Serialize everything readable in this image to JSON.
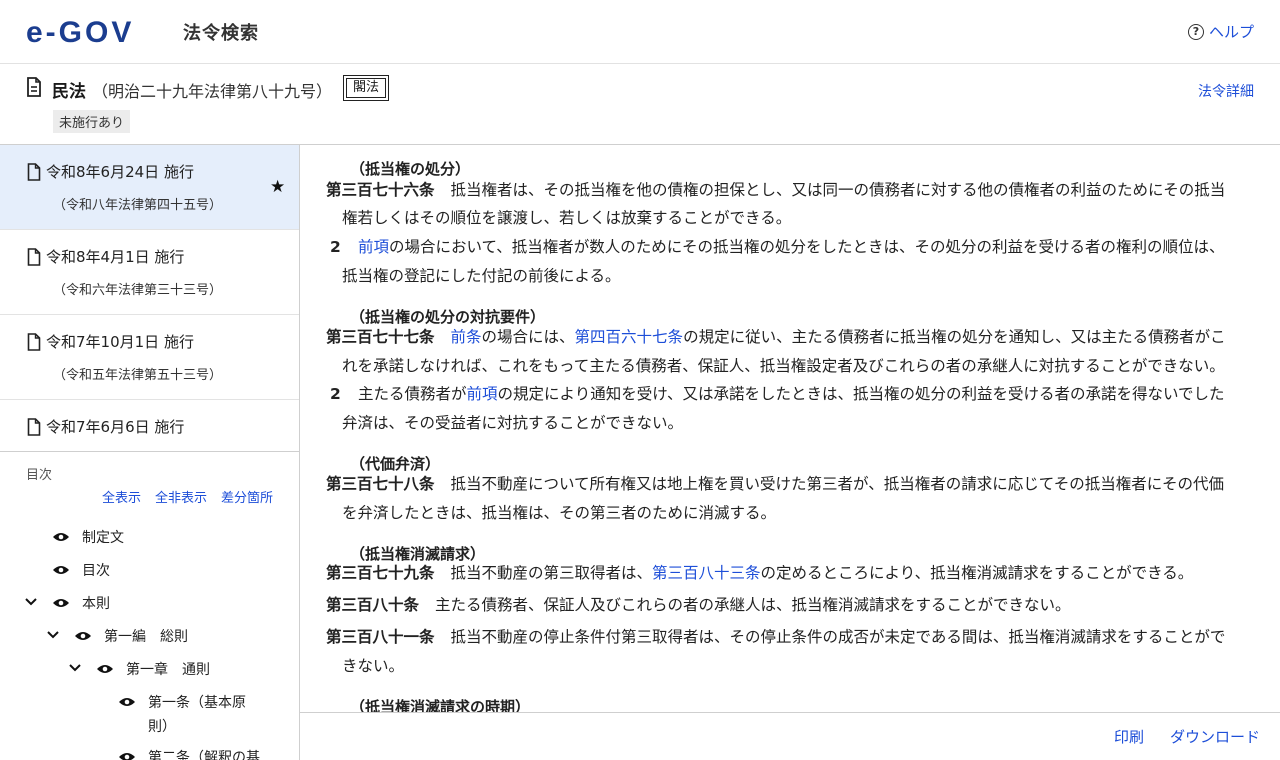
{
  "header": {
    "logo_text": "e-GOV",
    "app_title": "法令検索",
    "help_label": "ヘルプ"
  },
  "law": {
    "name": "民法",
    "number": "（明治二十九年法律第八十九号）",
    "type_badge": "閣法",
    "status_badge": "未施行あり",
    "detail_link": "法令詳細"
  },
  "revisions": [
    {
      "date": "令和8年6月24日 施行",
      "law": "（令和八年法律第四十五号）",
      "active": true
    },
    {
      "date": "令和8年4月1日 施行",
      "law": "（令和六年法律第三十三号）",
      "active": false
    },
    {
      "date": "令和7年10月1日 施行",
      "law": "（令和五年法律第五十三号）",
      "active": false
    },
    {
      "date": "令和7年6月6日 施行",
      "law": "",
      "active": false
    }
  ],
  "toc": {
    "label": "目次",
    "actions": {
      "show_all": "全表示",
      "hide_all": "全非表示",
      "diff": "差分箇所"
    },
    "items": [
      {
        "label": "制定文"
      },
      {
        "label": "目次"
      },
      {
        "label": "本則"
      },
      {
        "label": "第一編　総則"
      },
      {
        "label": "第一章　通則"
      },
      {
        "label_line1": "第一条（基本原",
        "label_line2": "則）"
      },
      {
        "label": "第二条（解釈の基"
      }
    ]
  },
  "content": {
    "caption1": "（抵当権の処分）",
    "a376": {
      "num": "第三百七十六条",
      "text": "抵当権者は、その抵当権を他の債権の担保とし、又は同一の債務者に対する他の債権者の利益のためにその抵当",
      "text2": "権若しくはその順位を譲渡し、若しくは放棄することができる。",
      "p2_num": "2",
      "p2_link": "前項",
      "p2_text": "の場合において、抵当権者が数人のためにその抵当権の処分をしたときは、その処分の利益を受ける者の権利の順位は、",
      "p2_text2": "抵当権の登記にした付記の前後による。"
    },
    "caption2": "（抵当権の処分の対抗要件）",
    "a377": {
      "num": "第三百七十七条",
      "link1": "前条",
      "text1": "の場合には、",
      "link2": "第四百六十七条",
      "text2": "の規定に従い、主たる債務者に抵当権の処分を通知し、又は主たる債務者がこ",
      "text3": "れを承諾しなければ、これをもって主たる債務者、保証人、抵当権設定者及びこれらの者の承継人に対抗することができない。",
      "p2_num": "2",
      "p2_pre": "主たる債務者が",
      "p2_link": "前項",
      "p2_text": "の規定により通知を受け、又は承諾をしたときは、抵当権の処分の利益を受ける者の承諾を得ないでした",
      "p2_text2": "弁済は、その受益者に対抗することができない。"
    },
    "caption3": "（代価弁済）",
    "a378": {
      "num": "第三百七十八条",
      "text": "抵当不動産について所有権又は地上権を買い受けた第三者が、抵当権者の請求に応じてその抵当権者にその代価",
      "text2": "を弁済したときは、抵当権は、その第三者のために消滅する。"
    },
    "caption4": "（抵当権消滅請求）",
    "a379": {
      "num": "第三百七十九条",
      "pre": "抵当不動産の第三取得者は、",
      "link": "第三百八十三条",
      "text": "の定めるところにより、抵当権消滅請求をすることができる。"
    },
    "a380": {
      "num": "第三百八十条",
      "text": "主たる債務者、保証人及びこれらの者の承継人は、抵当権消滅請求をすることができない。"
    },
    "a381": {
      "num": "第三百八十一条",
      "text": "抵当不動産の停止条件付第三取得者は、その停止条件の成否が未定である間は、抵当権消滅請求をすることがで",
      "text2": "きない。"
    },
    "caption5": "（抵当権消滅請求の時期）"
  },
  "footer": {
    "print_label": "印刷",
    "download_label": "ダウンロード"
  },
  "colors": {
    "link": "#1d4ed8",
    "brand": "#1b3d8f",
    "active_bg": "#e5eefb"
  }
}
